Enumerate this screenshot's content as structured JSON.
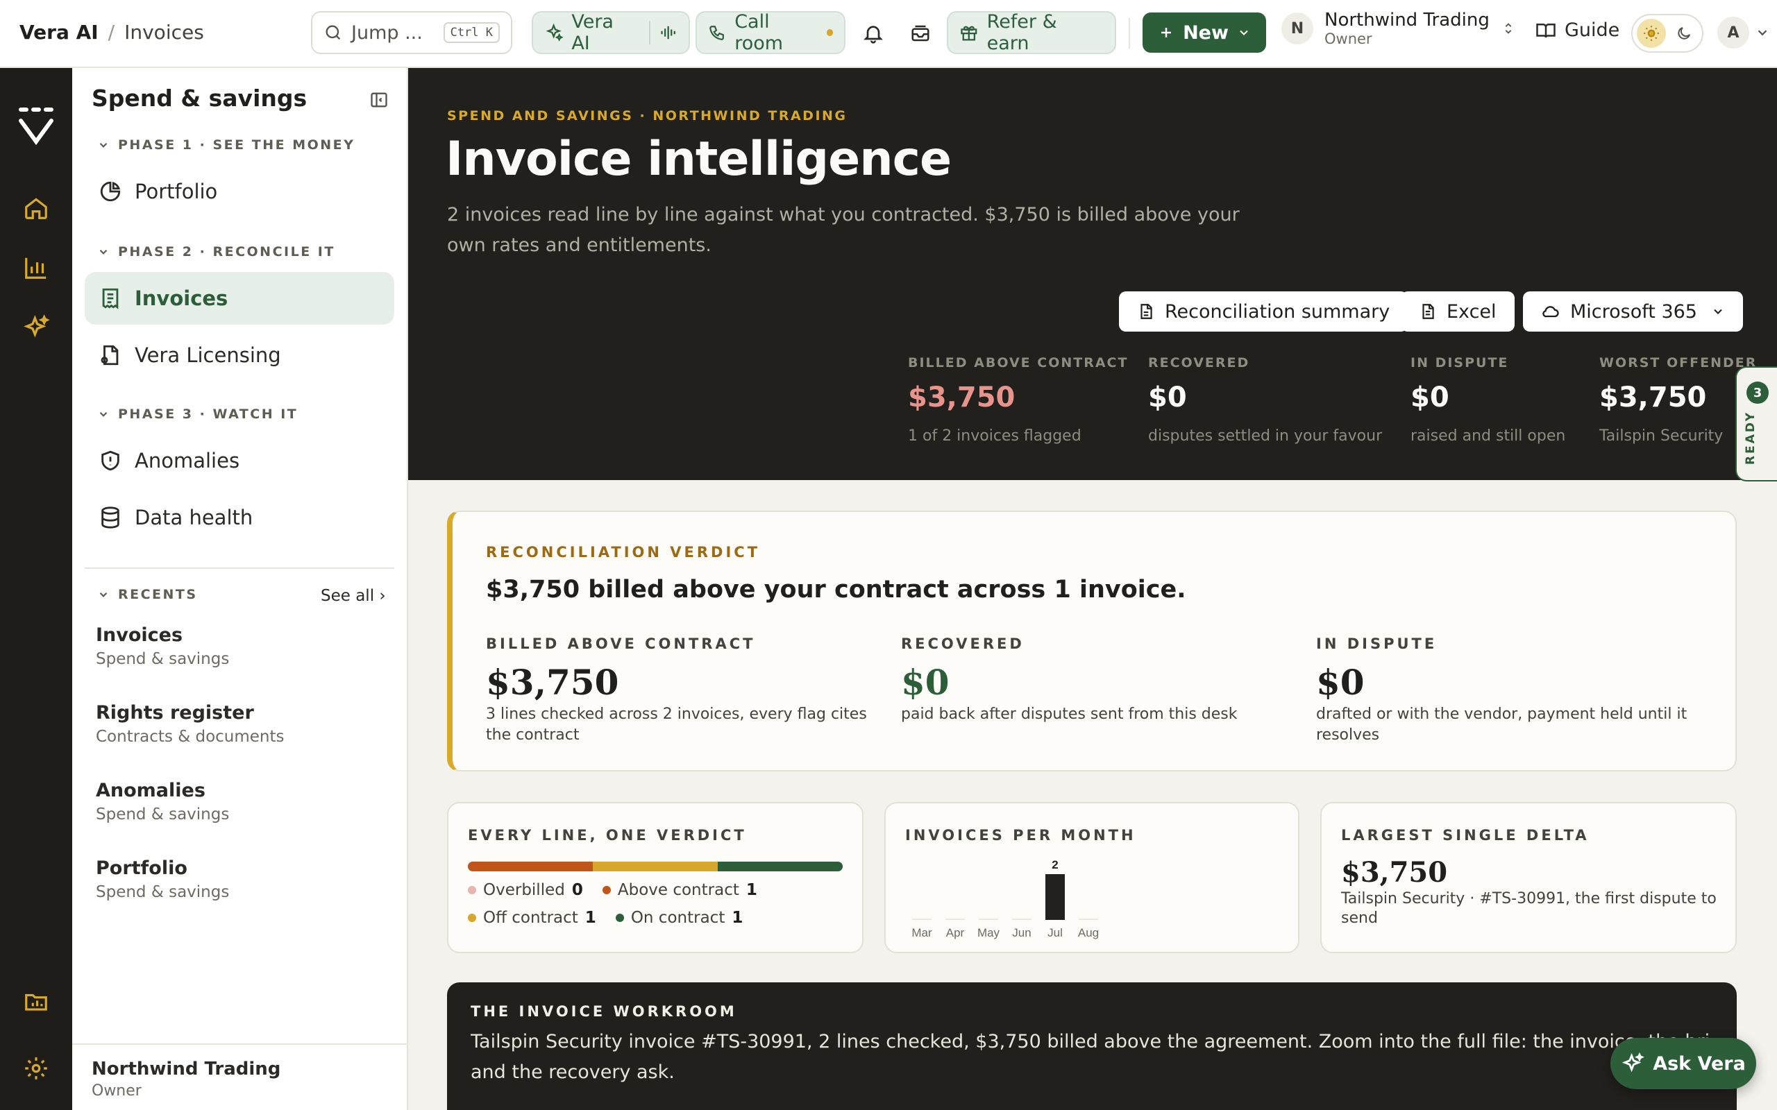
{
  "topbar": {
    "brand": "Vera AI",
    "page": "Invoices",
    "search_label": "Jump ...",
    "search_kbd": "Ctrl K",
    "vera_ai_label": "Vera AI",
    "call_room_label": "Call room",
    "refer_label": "Refer & earn",
    "new_label": "New",
    "org_initial": "N",
    "org_name": "Northwind Trading",
    "org_role": "Owner",
    "guide_label": "Guide",
    "avatar_initial": "A"
  },
  "sidebar": {
    "title": "Spend & savings",
    "phases": [
      {
        "label": "PHASE 1 · SEE THE MONEY"
      },
      {
        "label": "PHASE 2 · RECONCILE IT"
      },
      {
        "label": "PHASE 3 · WATCH IT"
      }
    ],
    "items": [
      {
        "label": "Portfolio",
        "icon": "pie-chart-icon"
      },
      {
        "label": "Invoices",
        "icon": "receipt-icon",
        "active": true
      },
      {
        "label": "Vera Licensing",
        "icon": "document-license-icon"
      },
      {
        "label": "Anomalies",
        "icon": "shield-alert-icon"
      },
      {
        "label": "Data health",
        "icon": "database-icon"
      }
    ],
    "recents_label": "RECENTS",
    "see_all_label": "See all ›",
    "recents": [
      {
        "title": "Invoices",
        "sub": "Spend & savings"
      },
      {
        "title": "Rights register",
        "sub": "Contracts & documents"
      },
      {
        "title": "Anomalies",
        "sub": "Spend & savings"
      },
      {
        "title": "Portfolio",
        "sub": "Spend & savings"
      }
    ],
    "footer_name": "Northwind Trading",
    "footer_role": "Owner"
  },
  "hero": {
    "eyebrow": "SPEND AND SAVINGS · NORTHWIND TRADING",
    "title": "Invoice intelligence",
    "lede": "2 invoices read line by line against what you contracted. $3,750 is billed above your own rates and entitlements.",
    "btn_summary": "Reconciliation summary",
    "btn_excel": "Excel",
    "btn_m365": "Microsoft 365",
    "stats": [
      {
        "label": "BILLED ABOVE CONTRACT",
        "value": "$3,750",
        "desc": "1 of 2 invoices flagged"
      },
      {
        "label": "RECOVERED",
        "value": "$0",
        "desc": "disputes settled in your favour"
      },
      {
        "label": "IN DISPUTE",
        "value": "$0",
        "desc": "raised and still open"
      },
      {
        "label": "WORST OFFENDER",
        "value": "$3,750",
        "desc": "Tailspin Security"
      }
    ],
    "ready_count": "3",
    "ready_label": "READY"
  },
  "verdict": {
    "eyebrow": "RECONCILIATION VERDICT",
    "headline": "$3,750 billed above your contract across 1 invoice.",
    "cols": [
      {
        "label": "BILLED ABOVE CONTRACT",
        "value": "$3,750",
        "desc": "3 lines checked across 2 invoices, every flag cites the contract"
      },
      {
        "label": "RECOVERED",
        "value": "$0",
        "desc": "paid back after disputes sent from this desk"
      },
      {
        "label": "IN DISPUTE",
        "value": "$0",
        "desc": "drafted or with the vendor, payment held until it resolves"
      }
    ]
  },
  "every_line": {
    "title": "EVERY LINE, ONE VERDICT",
    "segments": [
      {
        "label": "Overbilled",
        "count": "0",
        "color": "#e8b4b0"
      },
      {
        "label": "Above contract",
        "count": "1",
        "color": "#c0551a"
      },
      {
        "label": "Off contract",
        "count": "1",
        "color": "#d6a72a"
      },
      {
        "label": "On contract",
        "count": "1",
        "color": "#2c5e3a"
      }
    ]
  },
  "chart_data": {
    "type": "bar",
    "title": "INVOICES PER MONTH",
    "categories": [
      "Mar",
      "Apr",
      "May",
      "Jun",
      "Jul",
      "Aug"
    ],
    "values": [
      0,
      0,
      0,
      0,
      2,
      0
    ],
    "data_labels": [
      "",
      "",
      "",
      "",
      "2",
      ""
    ]
  },
  "largest_delta": {
    "title": "LARGEST SINGLE DELTA",
    "value": "$3,750",
    "desc": "Tailspin Security · #TS-30991, the first dispute to send"
  },
  "workroom": {
    "eyebrow": "THE INVOICE WORKROOM",
    "text_line1": "Tailspin Security invoice #TS-30991, 2 lines checked, $3,750 billed above the agreement. Zoom into the full file: the invoice, the brief, the bridge",
    "text_line2": "and the recovery ask."
  },
  "ask_label": "Ask Vera"
}
